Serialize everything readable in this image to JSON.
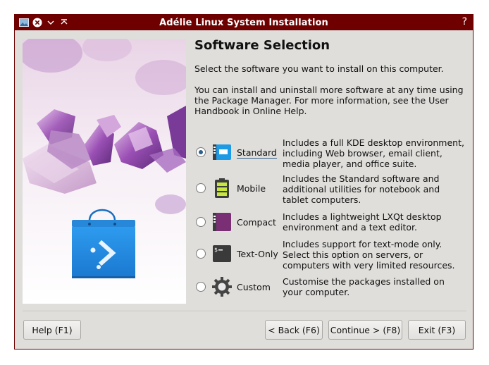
{
  "window": {
    "title": "Adélie Linux System Installation",
    "help_glyph": "?"
  },
  "page": {
    "heading": "Software Selection",
    "intro1": "Select the software you want to install on this computer.",
    "intro2": "You can install and uninstall more software at any time using the Package Manager.  For more information, see the User Handbook in Online Help."
  },
  "options": [
    {
      "label": "Standard",
      "icon": "kde-desktop-icon",
      "selected": true,
      "desc": "Includes a full KDE desktop environment, including Web browser, email client, media player, and office suite."
    },
    {
      "label": "Mobile",
      "icon": "battery-icon",
      "selected": false,
      "desc": "Includes the Standard software and additional utilities for notebook and tablet computers."
    },
    {
      "label": "Compact",
      "icon": "lxqt-desktop-icon",
      "selected": false,
      "desc": "Includes a lightweight LXQt desktop environment and a text editor."
    },
    {
      "label": "Text-Only",
      "icon": "terminal-icon",
      "selected": false,
      "desc": "Includes support for text-mode only.  Select this option on servers, or computers with very limited resources."
    },
    {
      "label": "Custom",
      "icon": "gear-icon",
      "selected": false,
      "desc": "Customise the packages installed on your computer."
    }
  ],
  "buttons": {
    "help": "Help (F1)",
    "back": "< Back (F6)",
    "continue": "Continue > (F8)",
    "exit": "Exit (F3)"
  },
  "colors": {
    "titlebar": "#6e0000",
    "window_bg": "#dfdedb",
    "accent": "#2e5e8a",
    "bag_blue": "#1f8be6"
  }
}
